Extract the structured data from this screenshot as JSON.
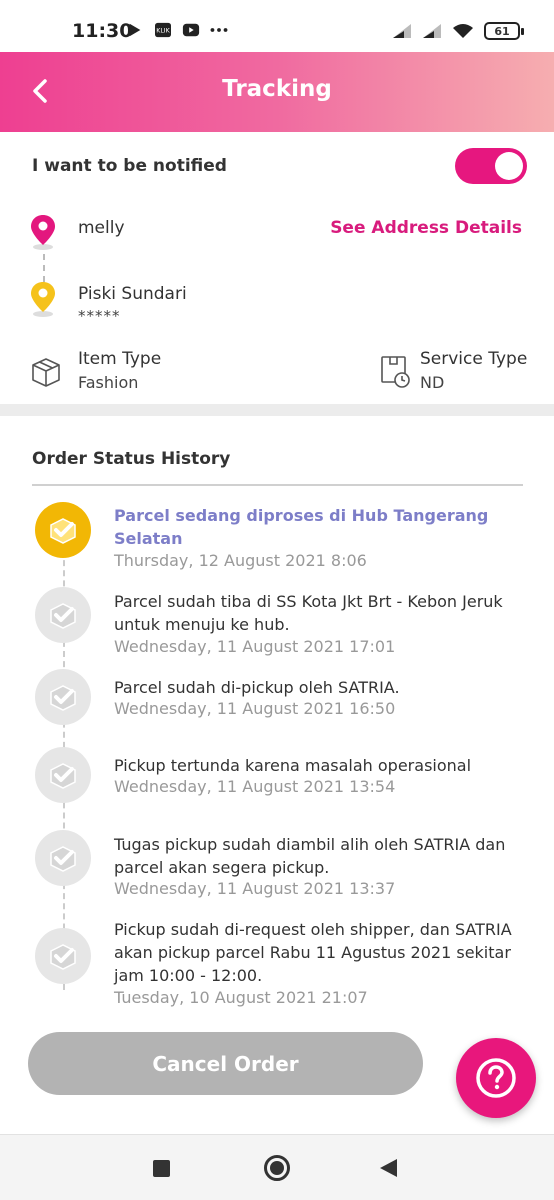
{
  "status_bar": {
    "time": "11:30",
    "battery": "61",
    "left_icons": [
      "play-store-icon",
      "klik-icon",
      "youtube-icon",
      "more-dots-icon"
    ],
    "right_icons": [
      "signal-1-icon",
      "signal-2-icon",
      "wifi-icon",
      "battery-icon"
    ]
  },
  "header": {
    "title": "Tracking",
    "gradient": [
      "#ee3f91",
      "#f6aeb0"
    ]
  },
  "notify": {
    "label": "I want to be notified",
    "enabled": true
  },
  "sender": {
    "name": "melly",
    "pin_color": "#e3177e"
  },
  "address_link": "See Address Details",
  "receiver": {
    "name": "Piski Sundari",
    "detail": "*****",
    "pin_color": "#f5c21b"
  },
  "item_type": {
    "label": "Item Type",
    "value": "Fashion"
  },
  "service_type": {
    "label": "Service Type",
    "value": "ND"
  },
  "order_status": {
    "title": "Order Status History",
    "entries": [
      {
        "text": "Parcel sedang diproses di Hub Tangerang Selatan",
        "time": "Thursday, 12 August 2021 8:06",
        "active": true
      },
      {
        "text": "Parcel sudah tiba di SS Kota Jkt Brt - Kebon Jeruk untuk menuju ke hub.",
        "time": "Wednesday, 11 August 2021 17:01",
        "active": false
      },
      {
        "text": "Parcel sudah di-pickup oleh SATRIA.",
        "time": "Wednesday, 11 August 2021 16:50",
        "active": false
      },
      {
        "text": "Pickup tertunda karena masalah operasional",
        "time": "Wednesday, 11 August 2021 13:54",
        "active": false
      },
      {
        "text": "Tugas pickup sudah diambil alih oleh SATRIA dan parcel akan segera pickup.",
        "time": "Wednesday, 11 August 2021 13:37",
        "active": false
      },
      {
        "text": "Pickup sudah di-request oleh shipper, dan SATRIA akan pickup parcel Rabu 11 Agustus 2021 sekitar jam 10:00 - 12:00.",
        "time": "Tuesday, 10 August 2021 21:07",
        "active": false
      }
    ]
  },
  "cancel_button": "Cancel Order",
  "help_button_icon": "help-question-icon",
  "accent_color": "#e6177f"
}
